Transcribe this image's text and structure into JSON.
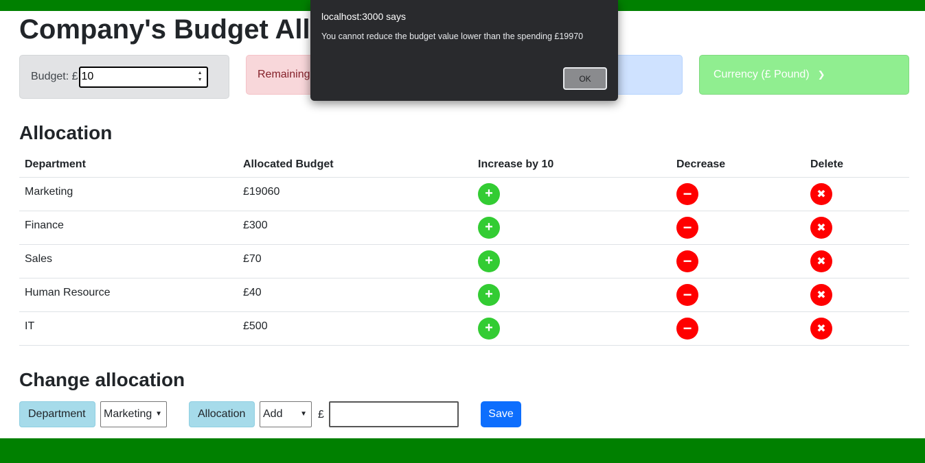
{
  "page": {
    "title": "Company's Budget Allo"
  },
  "budget": {
    "label": "Budget: £",
    "value": "10"
  },
  "remaining": {
    "label": "Remaining:"
  },
  "currency": {
    "label": "Currency (£ Pound)",
    "chevron": "chevron-down-icon"
  },
  "allocation": {
    "title": "Allocation",
    "headers": [
      "Department",
      "Allocated Budget",
      "Increase by 10",
      "Decrease",
      "Delete"
    ],
    "rows": [
      {
        "department": "Marketing",
        "budget": "£19060"
      },
      {
        "department": "Finance",
        "budget": "£300"
      },
      {
        "department": "Sales",
        "budget": "£70"
      },
      {
        "department": "Human Resource",
        "budget": "£40"
      },
      {
        "department": "IT",
        "budget": "£500"
      }
    ],
    "icons": {
      "increase": "plus-circle-icon",
      "decrease": "minus-circle-icon",
      "delete": "x-circle-icon"
    }
  },
  "change": {
    "title": "Change allocation",
    "department_tag": "Department",
    "department_selected": "Marketing",
    "allocation_tag": "Allocation",
    "operation_selected": "Add",
    "currency_symbol": "£",
    "amount_value": "",
    "save_label": "Save"
  },
  "dialog": {
    "title": "localhost:3000 says",
    "message": "You cannot reduce the budget value lower than the spending  £19970",
    "ok_label": "OK"
  },
  "colors": {
    "bar_green": "#008000",
    "increase_green": "#33cc33",
    "danger_red": "#ff0000",
    "currency_green": "#90ee90",
    "save_blue": "#0d6efd",
    "tag_blue": "#a6dbea"
  }
}
